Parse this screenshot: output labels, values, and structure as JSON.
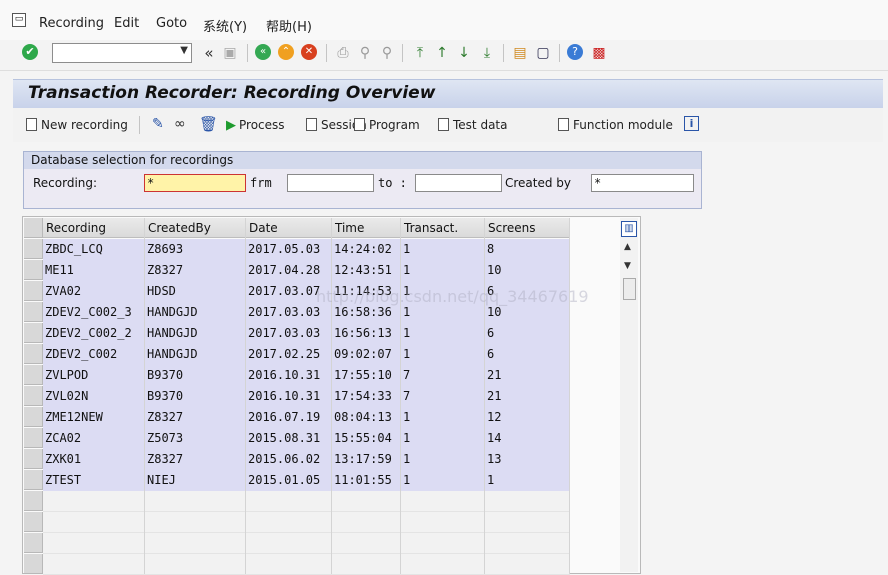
{
  "menubar": {
    "items": [
      {
        "label": "Recording"
      },
      {
        "label": "Edit"
      },
      {
        "label": "Goto"
      },
      {
        "label": "系统(Y)"
      },
      {
        "label": "帮助(H)"
      }
    ]
  },
  "toolbar": {
    "command_field_value": "",
    "icons": [
      "enter-check-icon",
      "save-icon",
      "back-icon",
      "exit-icon",
      "cancel-icon",
      "print-icon",
      "find-icon",
      "find-next-icon",
      "first-page-icon",
      "prev-page-icon",
      "next-page-icon",
      "last-page-icon",
      "new-session-icon",
      "shortcut-icon",
      "help-icon",
      "customize-layout-icon"
    ]
  },
  "title": "Transaction Recorder: Recording Overview",
  "app_toolbar": {
    "new_recording": "New recording",
    "process": "Process",
    "session": "Session",
    "program": "Program",
    "test_data": "Test data",
    "function_module": "Function module"
  },
  "selection": {
    "header": "Database selection for recordings",
    "recording_label": "Recording:",
    "recording_value": "*",
    "from_label": "frm",
    "from_value": "",
    "to_label": "to :",
    "to_value": "",
    "created_by_label": "Created by",
    "created_by_value": "*"
  },
  "table": {
    "columns": [
      "Recording",
      "CreatedBy",
      "Date",
      "Time",
      "Transact.",
      "Screens"
    ],
    "rows": [
      [
        "ZBDC_LCQ",
        "Z8693",
        "2017.05.03",
        "14:24:02",
        "1",
        "8"
      ],
      [
        "ME11",
        "Z8327",
        "2017.04.28",
        "12:43:51",
        "1",
        "10"
      ],
      [
        "ZVA02",
        "HDSD",
        "2017.03.07",
        "11:14:53",
        "1",
        "6"
      ],
      [
        "ZDEV2_C002_3",
        "HANDGJD",
        "2017.03.03",
        "16:58:36",
        "1",
        "10"
      ],
      [
        "ZDEV2_C002_2",
        "HANDGJD",
        "2017.03.03",
        "16:56:13",
        "1",
        "6"
      ],
      [
        "ZDEV2_C002",
        "HANDGJD",
        "2017.02.25",
        "09:02:07",
        "1",
        "6"
      ],
      [
        "ZVLPOD",
        "B9370",
        "2016.10.31",
        "17:55:10",
        "7",
        "21"
      ],
      [
        "ZVL02N",
        "B9370",
        "2016.10.31",
        "17:54:33",
        "7",
        "21"
      ],
      [
        "ZME12NEW",
        "Z8327",
        "2016.07.19",
        "08:04:13",
        "1",
        "12"
      ],
      [
        "ZCA02",
        "Z5073",
        "2015.08.31",
        "15:55:04",
        "1",
        "14"
      ],
      [
        "ZXK01",
        "Z8327",
        "2015.06.02",
        "13:17:59",
        "1",
        "13"
      ],
      [
        "ZTEST",
        "NIEJ",
        "2015.01.05",
        "11:01:55",
        "1",
        "1"
      ]
    ]
  },
  "watermark": "http://blog.csdn.net/qq_34467619",
  "colors": {
    "title_bg": "#c8d2ea",
    "row_bg": "#dcdcf3",
    "input_focus": "#fff3a8"
  }
}
